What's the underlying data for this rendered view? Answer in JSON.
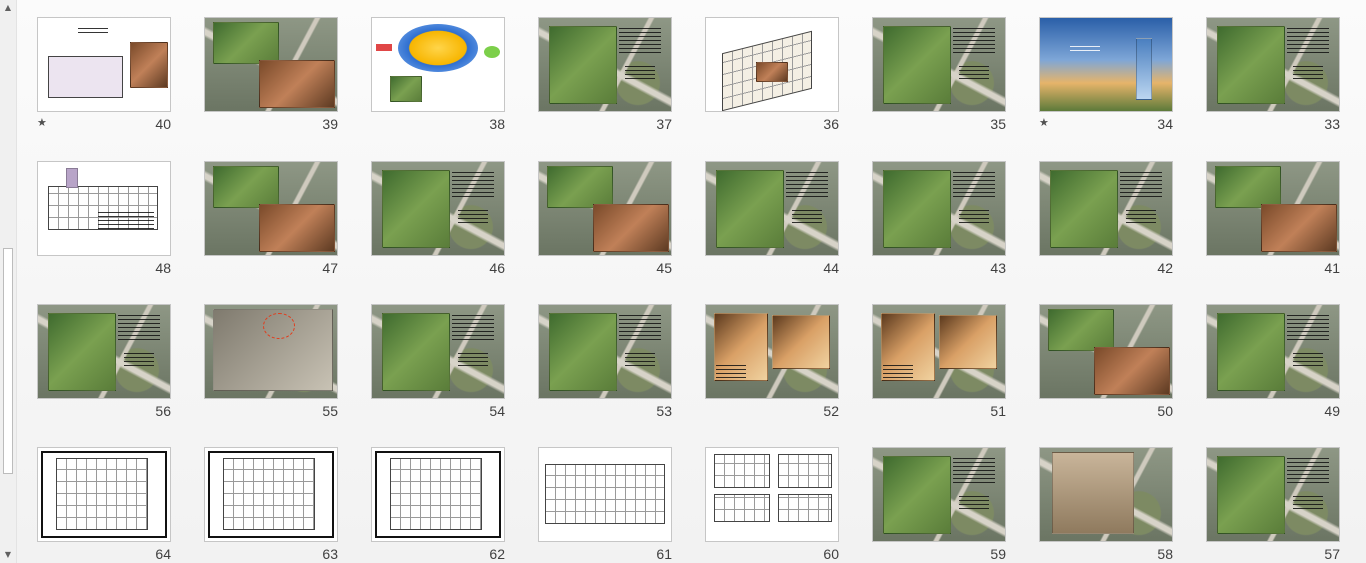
{
  "icons": {
    "scroll_up": "▲",
    "scroll_down": "▼",
    "star": "★"
  },
  "slides": [
    {
      "number": "40",
      "starred": true,
      "style": "diagram-line"
    },
    {
      "number": "39",
      "starred": false,
      "style": "map-photos"
    },
    {
      "number": "38",
      "starred": false,
      "style": "white-diagram"
    },
    {
      "number": "37",
      "starred": false,
      "style": "map-photo-text"
    },
    {
      "number": "36",
      "starred": false,
      "style": "white-axon"
    },
    {
      "number": "35",
      "starred": false,
      "style": "map-photo-text"
    },
    {
      "number": "34",
      "starred": true,
      "style": "sky-tower"
    },
    {
      "number": "33",
      "starred": false,
      "style": "map-photo-text"
    },
    {
      "number": "48",
      "starred": false,
      "style": "white-plan"
    },
    {
      "number": "47",
      "starred": false,
      "style": "map-photos"
    },
    {
      "number": "46",
      "starred": false,
      "style": "map-photo-text"
    },
    {
      "number": "45",
      "starred": false,
      "style": "map-photos"
    },
    {
      "number": "44",
      "starred": false,
      "style": "map-photo-text"
    },
    {
      "number": "43",
      "starred": false,
      "style": "map-photo-text"
    },
    {
      "number": "42",
      "starred": false,
      "style": "map-photo-text"
    },
    {
      "number": "41",
      "starred": false,
      "style": "map-photos"
    },
    {
      "number": "56",
      "starred": false,
      "style": "map-photo-text"
    },
    {
      "number": "55",
      "starred": false,
      "style": "map-sketch"
    },
    {
      "number": "54",
      "starred": false,
      "style": "map-photo-text"
    },
    {
      "number": "53",
      "starred": false,
      "style": "map-photo-text"
    },
    {
      "number": "52",
      "starred": false,
      "style": "map-interior"
    },
    {
      "number": "51",
      "starred": false,
      "style": "map-interior"
    },
    {
      "number": "50",
      "starred": false,
      "style": "map-photos"
    },
    {
      "number": "49",
      "starred": false,
      "style": "map-photo-text"
    },
    {
      "number": "64",
      "starred": false,
      "style": "plan-framed"
    },
    {
      "number": "63",
      "starred": false,
      "style": "plan-framed"
    },
    {
      "number": "62",
      "starred": false,
      "style": "plan-framed"
    },
    {
      "number": "61",
      "starred": false,
      "style": "section"
    },
    {
      "number": "60",
      "starred": false,
      "style": "elevations"
    },
    {
      "number": "59",
      "starred": false,
      "style": "map-photo-text"
    },
    {
      "number": "58",
      "starred": false,
      "style": "map-photo"
    },
    {
      "number": "57",
      "starred": false,
      "style": "map-photo-text"
    }
  ]
}
